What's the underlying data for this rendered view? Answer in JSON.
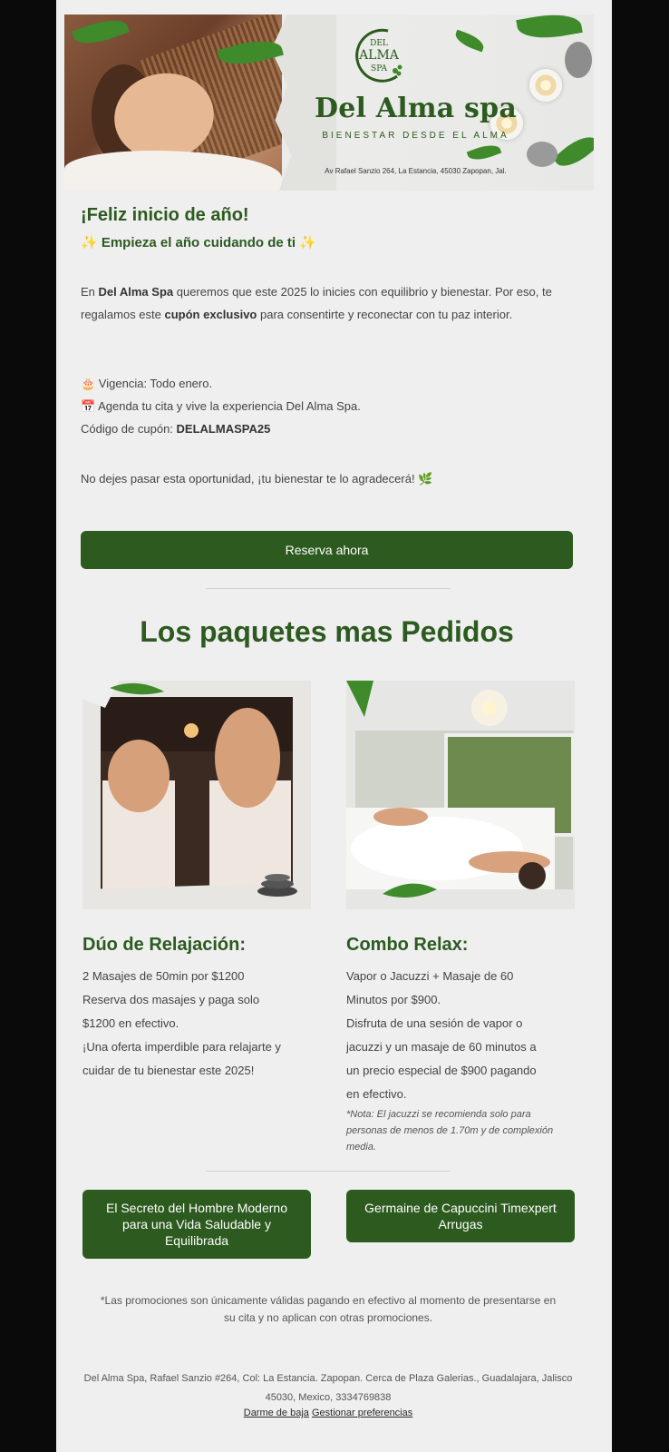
{
  "header": {
    "logo_text_top": "DEL",
    "logo_text_mid": "ALMA",
    "logo_text_bottom": "SPA",
    "brand_name": "Del Alma spa",
    "tagline": "BIENESTAR DESDE EL ALMA",
    "address": "Av Rafael Sanzio 264, La Estancia, 45030 Zapopan, Jal."
  },
  "intro": {
    "title": "¡Feliz inicio de año!",
    "subtitle": "✨ Empieza el año cuidando de ti ✨",
    "p1_a": "En ",
    "p1_b": "Del Alma Spa",
    "p1_c": " queremos que este 2025 lo inicies con equilibrio y bienestar. Por eso, te regalamos este ",
    "p1_d": "cupón exclusivo",
    "p1_e": " para consentirte y reconectar con tu paz interior.",
    "validity": "🎂 Vigencia: Todo enero.",
    "schedule": "📅 Agenda tu cita y vive la experiencia Del Alma Spa.",
    "coupon_label": "Código de cupón: ",
    "coupon_code": "DELALMASPA25",
    "closing": "No dejes pasar esta oportunidad, ¡tu bienestar te lo agradecerá! 🌿",
    "reserve_button": "Reserva ahora"
  },
  "packages": {
    "section_title": "Los paquetes mas Pedidos",
    "items": [
      {
        "title": "Dúo de Relajación:",
        "lines": [
          "2 Masajes de 50min por $1200",
          "Reserva dos masajes y paga solo",
          "$1200 en efectivo.",
          "¡Una oferta imperdible para relajarte y",
          "cuidar de tu bienestar este 2025!"
        ]
      },
      {
        "title": "Combo Relax:",
        "lines": [
          "Vapor o Jacuzzi + Masaje de 60",
          "Minutos por $900.",
          "Disfruta de una sesión de vapor o",
          "jacuzzi y un masaje de 60 minutos a",
          "un precio especial de $900 pagando",
          "en efectivo."
        ],
        "note": "*Nota: El jacuzzi se recomienda solo para personas de menos de 1.70m y de complexión media."
      }
    ]
  },
  "cta": {
    "left_button": "El Secreto del Hombre Moderno para una Vida Saludable y Equilibrada",
    "right_button": "Germaine de Capuccini Timexpert Arrugas"
  },
  "disclaimer": "*Las promociones son únicamente válidas pagando en efectivo al momento de presentarse en su cita y no aplican con otras promociones.",
  "footer": {
    "address": "Del Alma Spa, Rafael Sanzio #264, Col: La Estancia. Zapopan. Cerca de Plaza Galerias., Guadalajara, Jalisco 45030, Mexico, 3334769838",
    "unsubscribe": "Darme de baja",
    "preferences": "Gestionar preferencias"
  },
  "colors": {
    "brand_green": "#2c5a1f",
    "background": "#efefef",
    "page_frame": "#0a0a0a"
  }
}
